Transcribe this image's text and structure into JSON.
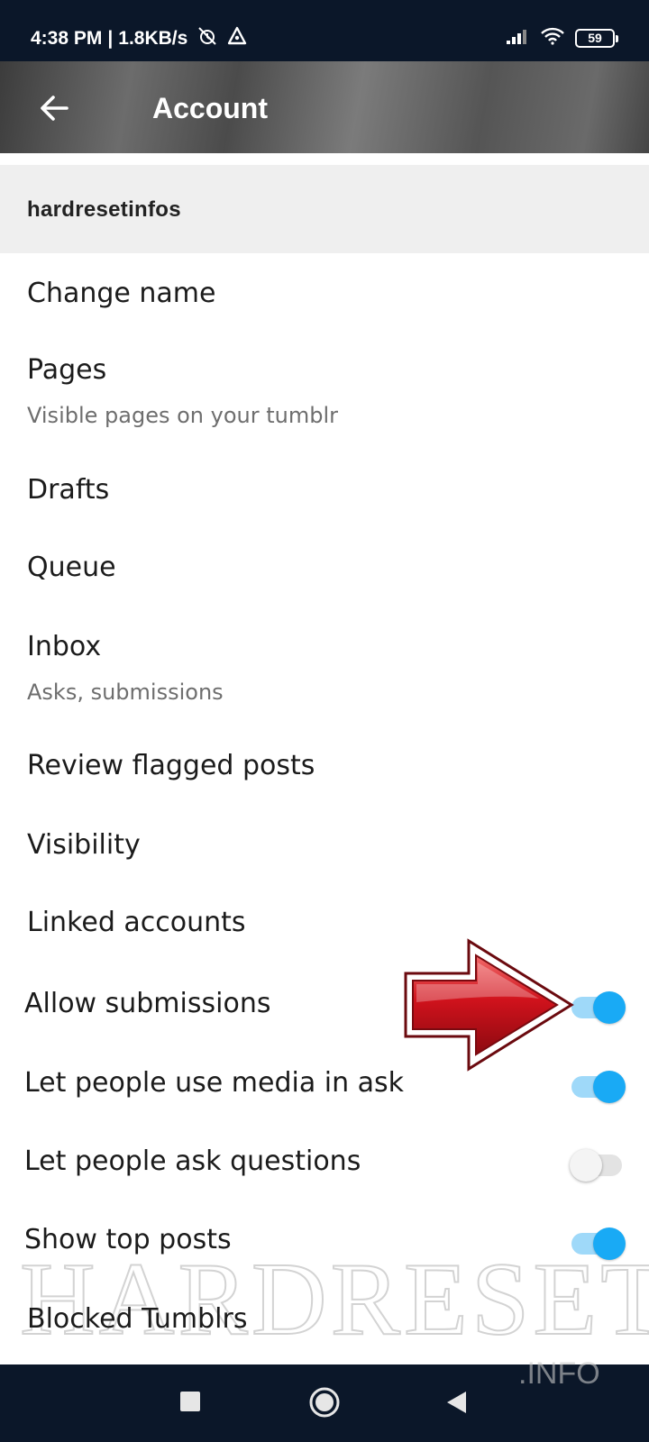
{
  "status_bar": {
    "time": "4:38 PM",
    "separator": "|",
    "network_speed": "1.8KB/s",
    "battery_level": "59"
  },
  "header": {
    "title": "Account",
    "back_icon": "arrow-left-icon"
  },
  "blog": {
    "name": "hardresetinfos"
  },
  "menu": {
    "change_name": {
      "title": "Change name"
    },
    "pages": {
      "title": "Pages",
      "subtitle": "Visible pages on your tumblr"
    },
    "drafts": {
      "title": "Drafts"
    },
    "queue": {
      "title": "Queue"
    },
    "inbox": {
      "title": "Inbox",
      "subtitle": "Asks, submissions"
    },
    "review_flagged": {
      "title": "Review flagged posts"
    },
    "visibility": {
      "title": "Visibility"
    },
    "linked_accounts": {
      "title": "Linked accounts"
    },
    "blocked_tumblrs": {
      "title": "Blocked Tumblrs"
    }
  },
  "toggles": [
    {
      "title": "Allow submissions",
      "on": true
    },
    {
      "title": "Let people use media in ask",
      "on": true
    },
    {
      "title": "Let people ask questions",
      "on": false
    },
    {
      "title": "Show top posts",
      "on": true
    }
  ],
  "watermark": {
    "text": "HARDRESET",
    "suffix": ".INFO"
  },
  "colors": {
    "status_bar": "#0b1729",
    "toggle_on_thumb": "#19aaf5",
    "toggle_on_track": "#9fd9f9",
    "toggle_off_thumb": "#f4f4f4",
    "arrow_red": "#d0121c"
  },
  "nav_bar": {
    "icons": [
      "recent-apps-icon",
      "home-icon",
      "back-triangle-icon"
    ]
  }
}
